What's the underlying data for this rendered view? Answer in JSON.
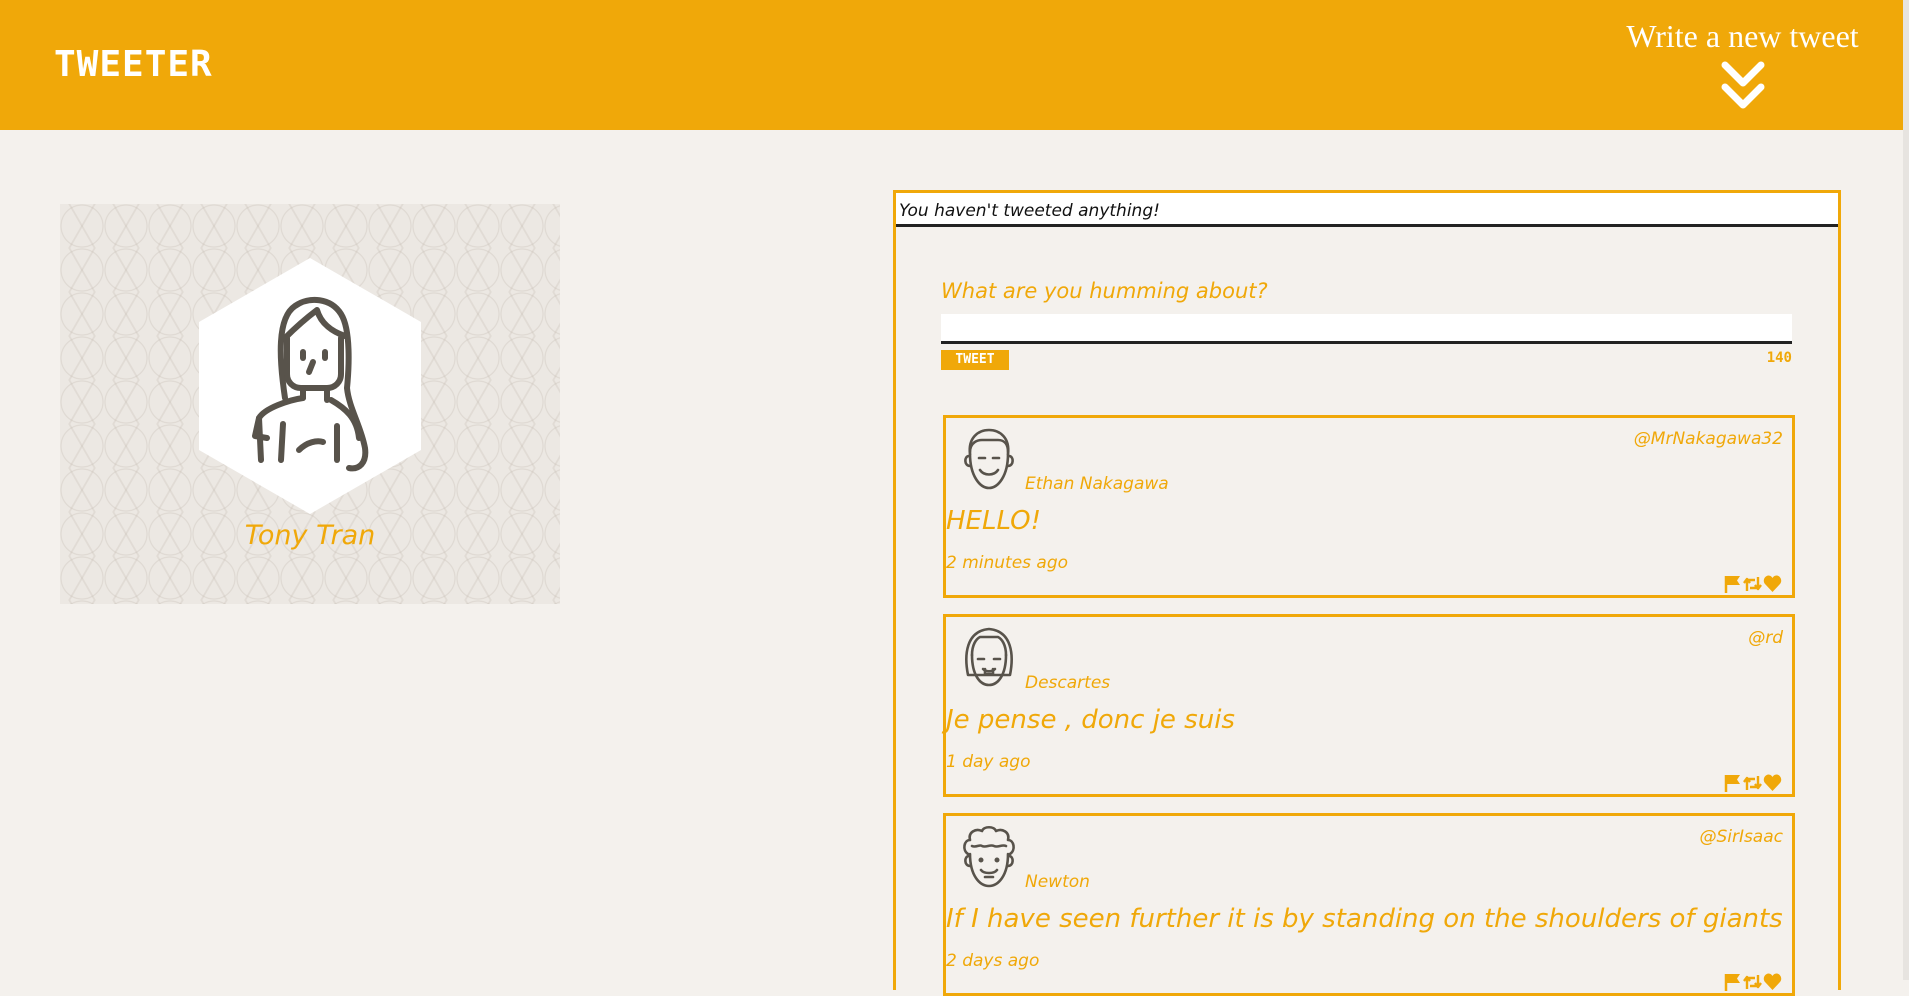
{
  "header": {
    "logo": "TWEETER",
    "compose_toggle_label": "Write a new tweet",
    "compose_toggle_icon": "double-chevron-down-icon"
  },
  "profile": {
    "name": "Tony Tran",
    "avatar_icon": "female-avatar-icon"
  },
  "feed": {
    "status_text": "You haven't tweeted anything!"
  },
  "compose": {
    "prompt": "What are you humming about?",
    "value": "",
    "button_label": "TWEET",
    "char_count": "140"
  },
  "tweets": [
    {
      "name": "Ethan Nakagawa",
      "handle": "@MrNakagawa32",
      "text": "HELLO!",
      "time": "2 minutes ago",
      "avatar_icon": "smiling-man-avatar-icon"
    },
    {
      "name": "Descartes",
      "handle": "@rd",
      "text": "Je pense , donc je suis",
      "time": "1 day ago",
      "avatar_icon": "bob-haircut-avatar-icon"
    },
    {
      "name": "Newton",
      "handle": "@SirIsaac",
      "text": "If I have seen further it is by standing on the shoulders of giants",
      "time": "2 days ago",
      "avatar_icon": "curly-hair-avatar-icon"
    }
  ],
  "tweet_action_icons": [
    "flag-icon",
    "retweet-icon",
    "heart-icon"
  ],
  "colors": {
    "accent": "#f0a809",
    "background": "#f4f1ed",
    "ink": "#58534b"
  }
}
